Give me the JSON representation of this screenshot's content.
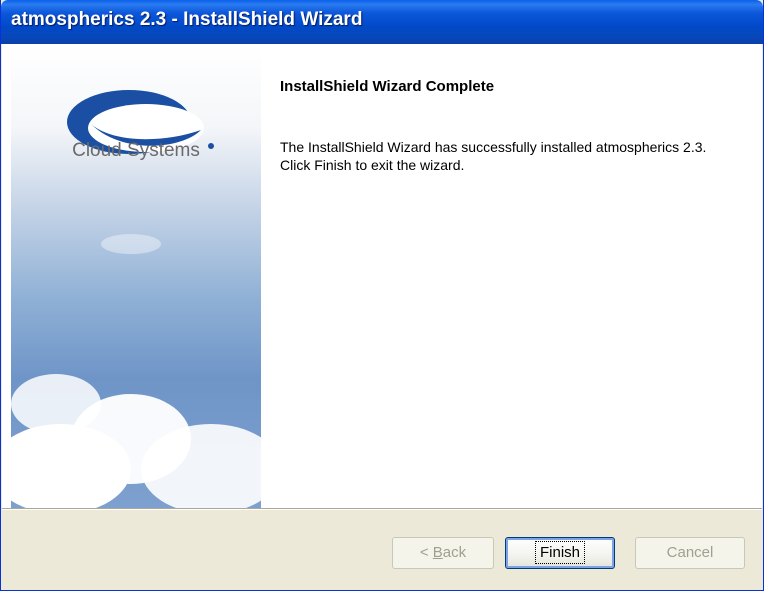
{
  "window": {
    "title": "atmospherics 2.3 - InstallShield Wizard"
  },
  "banner": {
    "logo_text": "Cloud Systems"
  },
  "main": {
    "heading": "InstallShield Wizard Complete",
    "message": "The InstallShield Wizard has successfully installed atmospherics 2.3.  Click Finish to exit the wizard."
  },
  "buttons": {
    "back_prefix": "< ",
    "back_accel": "B",
    "back_rest": "ack",
    "finish": "Finish",
    "cancel": "Cancel"
  },
  "colors": {
    "titlebar": "#0149c9",
    "logo_blue": "#1a4fa3",
    "face": "#ece9d8"
  }
}
